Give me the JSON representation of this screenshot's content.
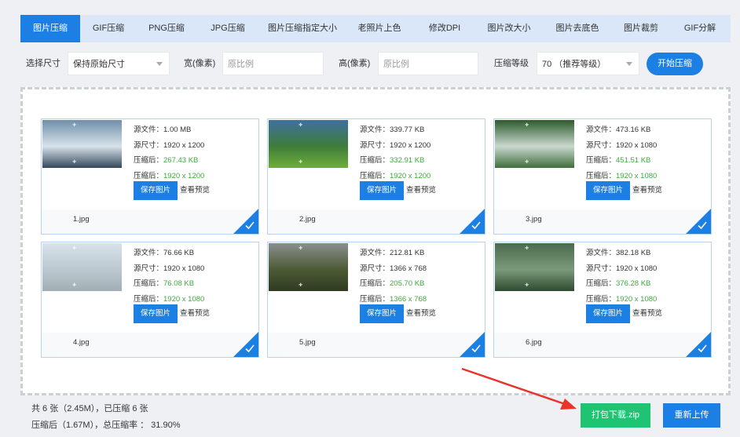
{
  "tabs": [
    {
      "label": "图片压缩",
      "active": true
    },
    {
      "label": "GIF压缩"
    },
    {
      "label": "PNG压缩"
    },
    {
      "label": "JPG压缩"
    },
    {
      "label": "图片压缩指定大小"
    },
    {
      "label": "老照片上色"
    },
    {
      "label": "修改DPI"
    },
    {
      "label": "图片改大小"
    },
    {
      "label": "图片去底色"
    },
    {
      "label": "图片裁剪"
    },
    {
      "label": "GIF分解"
    }
  ],
  "settings": {
    "size_label": "选择尺寸",
    "size_value": "保持原始尺寸",
    "width_label": "宽(像素)",
    "width_placeholder": "原比例",
    "height_label": "高(像素)",
    "height_placeholder": "原比例",
    "level_label": "压缩等级",
    "level_value": "70 （推荐等级）",
    "start_button": "开始压缩"
  },
  "card_labels": {
    "source_file": "源文件：",
    "source_size": "源尺寸：",
    "compressed": "压缩后：",
    "save_button": "保存图片",
    "preview_link": "查看预览"
  },
  "files": [
    {
      "name": "1.jpg",
      "source_file": "1.00 MB",
      "source_size": "1920 x 1200",
      "compressed_file": "267.43 KB",
      "compressed_size": "1920 x 1200",
      "thumb_colors": [
        "#6f8fa8",
        "#d8e2ea",
        "#33485a"
      ]
    },
    {
      "name": "2.jpg",
      "source_file": "339.77 KB",
      "source_size": "1920 x 1200",
      "compressed_file": "332.91 KB",
      "compressed_size": "1920 x 1200",
      "thumb_colors": [
        "#3f6f9e",
        "#3e7d3a",
        "#6fae3a"
      ]
    },
    {
      "name": "3.jpg",
      "source_file": "473.16 KB",
      "source_size": "1920 x 1080",
      "compressed_file": "451.51 KB",
      "compressed_size": "1920 x 1080",
      "thumb_colors": [
        "#2d5a2c",
        "#c9d8cf",
        "#3f6e3a"
      ]
    },
    {
      "name": "4.jpg",
      "source_file": "76.66 KB",
      "source_size": "1920 x 1080",
      "compressed_file": "76.08 KB",
      "compressed_size": "1920 x 1080",
      "thumb_colors": [
        "#d7e2ea",
        "#bcc8cf",
        "#a1afb5"
      ]
    },
    {
      "name": "5.jpg",
      "source_file": "212.81 KB",
      "source_size": "1366 x 768",
      "compressed_file": "205.70 KB",
      "compressed_size": "1366 x 768",
      "thumb_colors": [
        "#8a8f8e",
        "#4d5a35",
        "#2f3a22"
      ]
    },
    {
      "name": "6.jpg",
      "source_file": "382.18 KB",
      "source_size": "1920 x 1080",
      "compressed_file": "376.28 KB",
      "compressed_size": "1920 x 1080",
      "thumb_colors": [
        "#4b6a4f",
        "#7b9a7a",
        "#2f4a30"
      ]
    }
  ],
  "stats": {
    "line1": "共 6 张（2.45M），已压缩 6 张",
    "line2": "压缩后（1.67M），总压缩率 ： 31.90%"
  },
  "actions": {
    "zip_button": "打包下载.zip",
    "reupload_button": "重新上传"
  },
  "colors": {
    "primary": "#1b7fe3",
    "success_green": "#1ec472",
    "value_green": "#3fa83f",
    "annotation_red": "#e8342c"
  }
}
